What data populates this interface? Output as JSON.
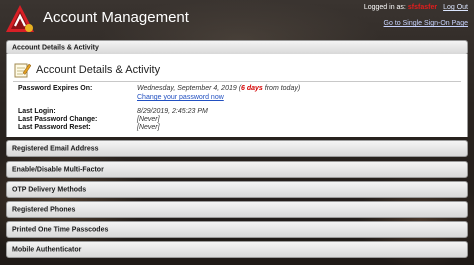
{
  "header": {
    "title": "Account Management",
    "logged_in_prefix": "Logged in as:",
    "user": "sfsfasfer",
    "logout": "Log Out",
    "sso_link": "Go to Single Sign-On Page"
  },
  "top_panel": {
    "label": "Account Details & Activity"
  },
  "details": {
    "heading": "Account Details & Activity",
    "password_expires_label": "Password Expires On:",
    "password_expires_date": "Wednesday, September 4, 2019 (",
    "password_expires_days": "6 days",
    "password_expires_suffix": " from today)",
    "change_password_link": "Change your password now",
    "last_login_label": "Last Login:",
    "last_login_value": "8/29/2019, 2:45:23 PM",
    "last_password_change_label": "Last Password Change:",
    "last_password_change_value": "[Never]",
    "last_password_reset_label": "Last Password Reset:",
    "last_password_reset_value": "[Never]"
  },
  "panels": [
    {
      "label": "Registered Email Address"
    },
    {
      "label": "Enable/Disable Multi-Factor"
    },
    {
      "label": "OTP Delivery Methods"
    },
    {
      "label": "Registered Phones"
    },
    {
      "label": "Printed One Time Passcodes"
    },
    {
      "label": "Mobile Authenticator"
    }
  ],
  "colors": {
    "accent_red": "#d40000",
    "link_blue": "#2250c0"
  },
  "icons": {
    "logo": "brand-logo-icon",
    "section": "notepad-pencil-icon"
  }
}
